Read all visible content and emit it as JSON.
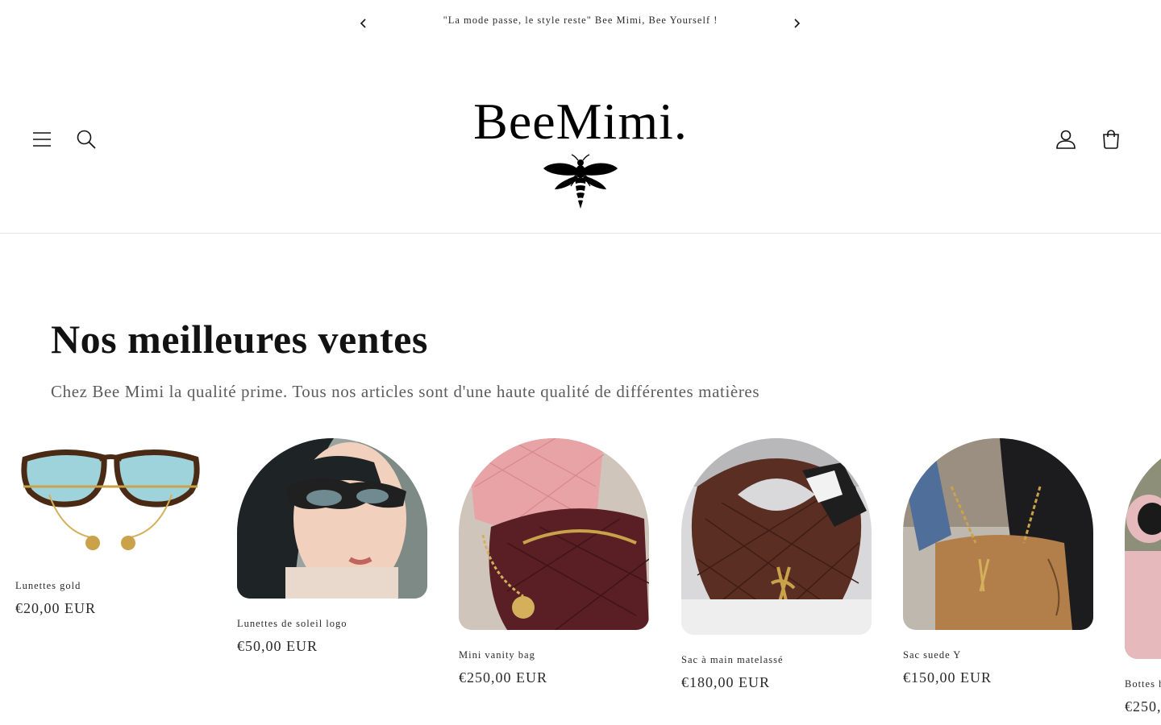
{
  "announcement": {
    "message": "\"La mode passe, le style reste\" Bee Mimi, Bee Yourself !"
  },
  "header": {
    "logo_text": "BeeMimi."
  },
  "section": {
    "title": "Nos meilleures ventes",
    "subtitle": "Chez Bee Mimi la qualité prime. Tous nos articles sont d'une haute qualité de différentes matières"
  },
  "products": [
    {
      "name": "Lunettes gold",
      "price": "€20,00 EUR"
    },
    {
      "name": "Lunettes de soleil logo",
      "price": "€50,00 EUR"
    },
    {
      "name": "Mini vanity bag",
      "price": "€250,00 EUR"
    },
    {
      "name": "Sac à main matelassé",
      "price": "€180,00 EUR"
    },
    {
      "name": "Sac suede Y",
      "price": "€150,00 EUR"
    },
    {
      "name": "Bottes h",
      "price": "€250,"
    }
  ]
}
